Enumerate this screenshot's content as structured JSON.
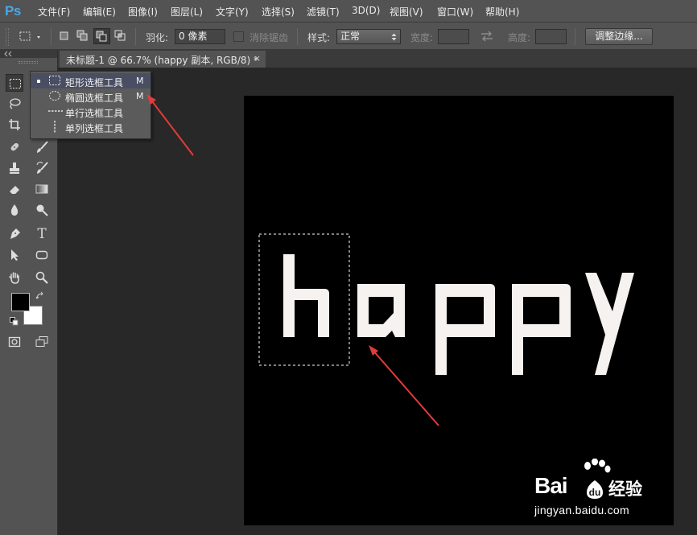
{
  "app": {
    "logo": "Ps"
  },
  "menu": {
    "items": [
      "文件(F)",
      "编辑(E)",
      "图像(I)",
      "图层(L)",
      "文字(Y)",
      "选择(S)",
      "滤镜(T)",
      "3D(D)",
      "视图(V)",
      "窗口(W)",
      "帮助(H)"
    ]
  },
  "options": {
    "feather_label": "羽化:",
    "feather_value": "0 像素",
    "antialias_label": "消除锯齿",
    "style_label": "样式:",
    "style_value": "正常",
    "width_label": "宽度:",
    "height_label": "高度:",
    "refine_edge_button": "调整边缘..."
  },
  "document": {
    "tab_title": "未标题-1 @ 66.7% (happy 副本, RGB/8) *",
    "close_glyph": "×",
    "canvas_text": "happy",
    "canvas_background": "#000000",
    "text_color": "#ffffff"
  },
  "flyout": {
    "items": [
      {
        "label": "矩形选框工具",
        "shortcut": "M",
        "icon": "rect-marquee-icon",
        "selected": true
      },
      {
        "label": "椭圆选框工具",
        "shortcut": "M",
        "icon": "ellipse-marquee-icon",
        "selected": false
      },
      {
        "label": "单行选框工具",
        "shortcut": "",
        "icon": "single-row-marquee-icon",
        "selected": false
      },
      {
        "label": "单列选框工具",
        "shortcut": "",
        "icon": "single-column-marquee-icon",
        "selected": false
      }
    ]
  },
  "watermark": {
    "brand": "Bai",
    "brand_suffix": "经验",
    "url": "jingyan.baidu.com"
  },
  "colors": {
    "accent_arrow": "#e23b3b",
    "ps_blue": "#4aa7e8",
    "foreground": "#000000",
    "background": "#ffffff"
  }
}
